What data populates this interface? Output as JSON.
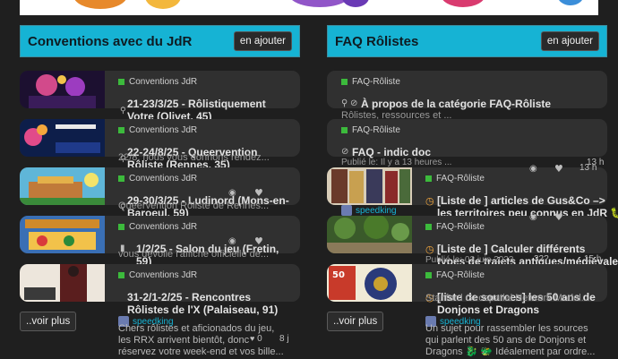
{
  "left": {
    "title": "Conventions avec du JdR",
    "add_label": "en ajouter",
    "more_label": "..voir plus",
    "topics": [
      {
        "category": "Conventions JdR",
        "title_l1": "21-23/3/25 - Rôlistiquement",
        "title_l2": "Votre (Olivet, 45)"
      },
      {
        "category": "Conventions JdR",
        "title_l1": "22-24/8/25 - Queervention",
        "title_l2": "Rôliste (Rennes, 35)"
      },
      {
        "category": "Conventions JdR",
        "title_l1": "29-30/3/25 - Ludinord (Mons-en-",
        "title_l2": "Baroeul, 59)"
      },
      {
        "category": "Conventions JdR",
        "title_l1": "1/2/25 - Salon du jeu (Fretin,",
        "title_l2": "59)"
      },
      {
        "category": "Conventions JdR",
        "title_l1": "31-2/1-2/25 - Rencontres",
        "title_l2": "Rôlistes de l'X (Palaiseau, 91)"
      }
    ],
    "bleed_lines": {
      "t2": "22/8, nous vous donnons rendez...",
      "t3": "Queervention Rôliste de Rennes...",
      "t4": "vous dévoile l'affiche officielle de...",
      "excerpt_l1": "Chers rôlistes et aficionados du jeu,",
      "excerpt_l2": "les RRX arrivent bientôt, donc",
      "excerpt_l3": "réservez votre week-end et vos bille..."
    },
    "user": "speedking",
    "stats": {
      "replies": "0",
      "age": "8 j"
    }
  },
  "right": {
    "title": "FAQ Rôlistes",
    "add_label": "en ajouter",
    "more_label": "..voir plus",
    "topics": [
      {
        "category": "FAQ-Rôliste",
        "title_l1": "À propos de la catégorie FAQ-Rôliste",
        "title_l2": ""
      },
      {
        "category": "FAQ-Rôliste",
        "title_l1": "FAQ - indic doc",
        "title_l2": ""
      },
      {
        "category": "FAQ-Rôliste",
        "title_l1": "[Liste de ] articles de Gus&Co –>",
        "title_l2": "les territoires peu connus en JdR 🐛"
      },
      {
        "category": "FAQ-Rôliste",
        "title_l1": "[Liste de ] Calculer différents",
        "title_l2": "types de trajets antiques/médiévales"
      },
      {
        "category": "FAQ-Rôliste",
        "title_l1": "[liste de sources] les 50 ans de",
        "title_l2": "Donjons et Dragons"
      }
    ],
    "bleed_lines": {
      "t1": "Rôlistes, ressources et ...",
      "t2": "Publié le: Il y a 13 heures ...",
      "t4": "Publié le: 03 juin 2023",
      "t4b": "32?",
      "t5": "Stanford Geospatial Network Model...",
      "excerpt_l1": "Un sujet pour rassembler les sources",
      "excerpt_l2": "qui parlent des 50 ans de Donjons et",
      "excerpt_l3": "Dragons 🐉 🐲 Idéalement par ordre..."
    },
    "user": "speedking",
    "stats": {
      "age_a": "13 h",
      "age_b": "13 h",
      "age_c": "15 h"
    }
  },
  "colors": {
    "accent": "#16b3d4",
    "card": "#303030",
    "category": "#3cba3c"
  }
}
